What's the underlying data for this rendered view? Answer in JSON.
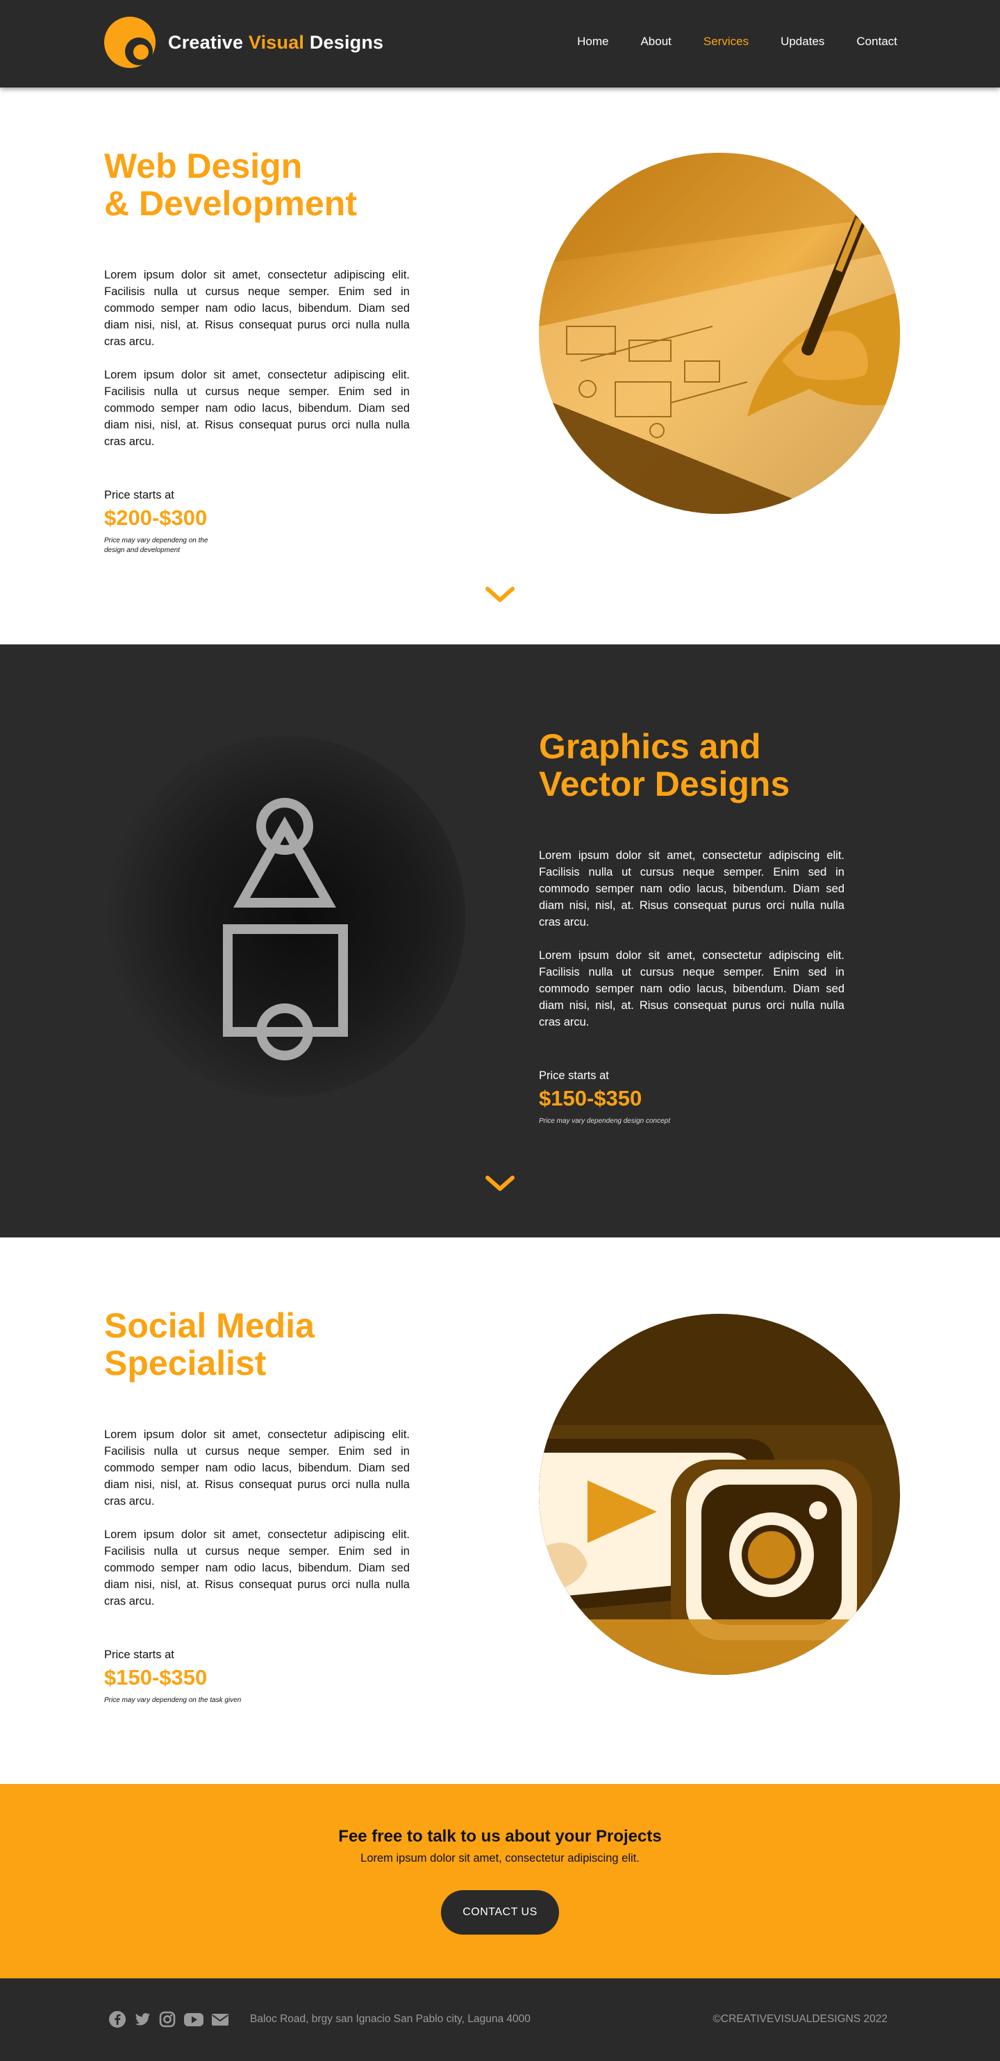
{
  "brand": {
    "name_part1": "Creative ",
    "name_accent": "Visual",
    "name_part2": " Designs"
  },
  "nav": {
    "items": [
      {
        "label": "Home",
        "active": false
      },
      {
        "label": "About",
        "active": false
      },
      {
        "label": "Services",
        "active": true
      },
      {
        "label": "Updates",
        "active": false
      },
      {
        "label": "Contact",
        "active": false
      }
    ]
  },
  "services": [
    {
      "title_line1": "Web Design",
      "title_line2": "& Development",
      "paragraph1": "Lorem ipsum dolor sit amet, consectetur adipiscing elit. Facilisis nulla ut cursus neque semper. Enim sed in commodo semper nam odio lacus, bibendum. Diam sed diam nisi, nisl, at. Risus consequat purus orci nulla nulla cras arcu.",
      "paragraph2": "Lorem ipsum dolor sit amet, consectetur adipiscing elit. Facilisis nulla ut cursus neque semper. Enim sed in commodo semper nam odio lacus, bibendum. Diam sed diam nisi, nisl, at. Risus consequat purus orci nulla nulla cras arcu.",
      "price_label": "Price starts at",
      "price": "$200-$300",
      "price_note": "Price may vary dependeng on the design and development"
    },
    {
      "title_line1": "Graphics and",
      "title_line2": "Vector Designs",
      "paragraph1": "Lorem ipsum dolor sit amet, consectetur adipiscing elit. Facilisis nulla ut cursus neque semper. Enim sed in commodo semper nam odio lacus, bibendum. Diam sed diam nisi, nisl, at. Risus consequat purus orci nulla nulla cras arcu.",
      "paragraph2": "Lorem ipsum dolor sit amet, consectetur adipiscing elit. Facilisis nulla ut cursus neque semper. Enim sed in commodo semper nam odio lacus, bibendum. Diam sed diam nisi, nisl, at. Risus consequat purus orci nulla nulla cras arcu.",
      "price_label": "Price starts at",
      "price": "$150-$350",
      "price_note": "Price may vary dependeng design concept"
    },
    {
      "title_line1": "Social Media",
      "title_line2": "Specialist",
      "paragraph1": "Lorem ipsum dolor sit amet, consectetur adipiscing elit. Facilisis nulla ut cursus neque semper. Enim sed in commodo semper nam odio lacus, bibendum. Diam sed diam nisi, nisl, at. Risus consequat purus orci nulla nulla cras arcu.",
      "paragraph2": "Lorem ipsum dolor sit amet, consectetur adipiscing elit. Facilisis nulla ut cursus neque semper. Enim sed in commodo semper nam odio lacus, bibendum. Diam sed diam nisi, nisl, at. Risus consequat purus orci nulla nulla cras arcu.",
      "price_label": "Price starts at",
      "price": "$150-$350",
      "price_note": "Price may vary dependeng on the task given"
    }
  ],
  "cta": {
    "title": "Fee free to talk to us about your Projects",
    "subtitle": "Lorem ipsum dolor sit amet, consectetur adipiscing elit.",
    "button_label": "CONTACT US"
  },
  "footer": {
    "social_icons": [
      "facebook-icon",
      "twitter-icon",
      "instagram-icon",
      "youtube-icon",
      "email-icon"
    ],
    "address": "Baloc Road, brgy san Ignacio San Pablo city, Laguna 4000",
    "copyright": "©CREATIVEVISUALDESIGNS 2022"
  },
  "colors": {
    "accent": "#fba313",
    "dark": "#2a2a2a",
    "text": "#111111"
  }
}
